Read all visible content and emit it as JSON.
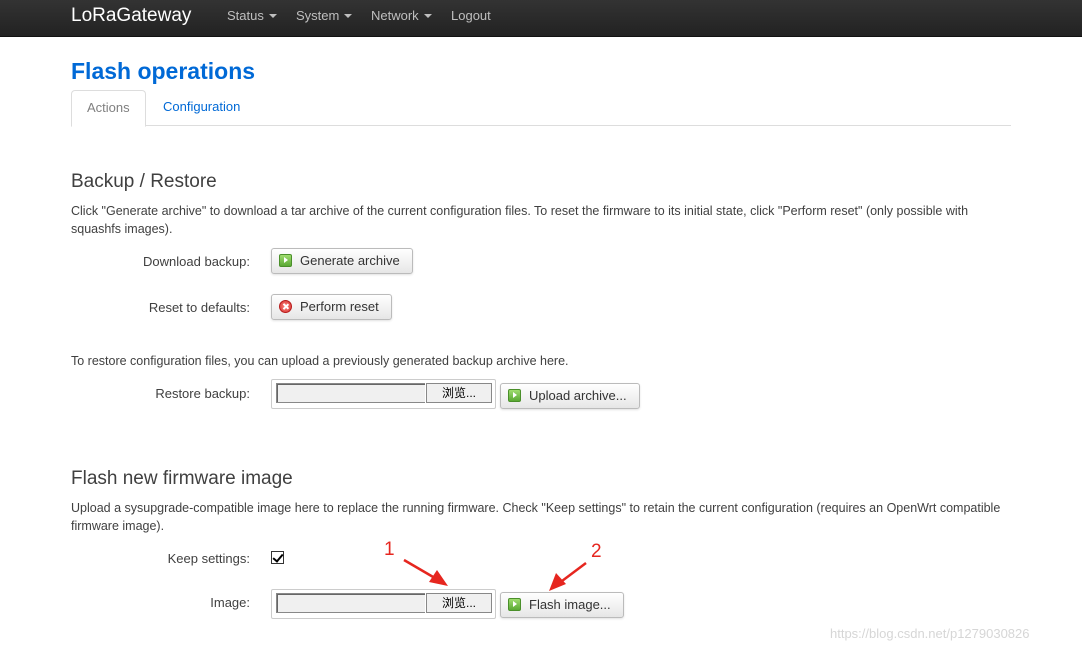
{
  "navbar": {
    "brand": "LoRaGateway",
    "items": [
      {
        "label": "Status",
        "dropdown": true
      },
      {
        "label": "System",
        "dropdown": true
      },
      {
        "label": "Network",
        "dropdown": true
      },
      {
        "label": "Logout",
        "dropdown": false
      }
    ]
  },
  "page": {
    "title": "Flash operations",
    "tabs": [
      {
        "label": "Actions",
        "active": true
      },
      {
        "label": "Configuration",
        "active": false
      }
    ]
  },
  "backup": {
    "title": "Backup / Restore",
    "description": "Click \"Generate archive\" to download a tar archive of the current configuration files. To reset the firmware to its initial state, click \"Perform reset\" (only possible with squashfs images).",
    "download_label": "Download backup:",
    "generate_button": "Generate archive",
    "reset_label": "Reset to defaults:",
    "reset_button": "Perform reset",
    "restore_description": "To restore configuration files, you can upload a previously generated backup archive here.",
    "restore_label": "Restore backup:",
    "browse_button": "浏览...",
    "upload_button": "Upload archive..."
  },
  "flash": {
    "title": "Flash new firmware image",
    "description": "Upload a sysupgrade-compatible image here to replace the running firmware. Check \"Keep settings\" to retain the current configuration (requires an OpenWrt compatible firmware image).",
    "keep_label": "Keep settings:",
    "keep_checked": true,
    "image_label": "Image:",
    "browse_button": "浏览...",
    "flash_button": "Flash image..."
  },
  "annotations": {
    "marker_1": "1",
    "marker_2": "2",
    "color": "#e6261f"
  },
  "watermark": "https://blog.csdn.net/p1279030826",
  "colors": {
    "navbar_bg": "#222222",
    "title_blue": "#0069d6",
    "link_blue": "#0069d6"
  }
}
